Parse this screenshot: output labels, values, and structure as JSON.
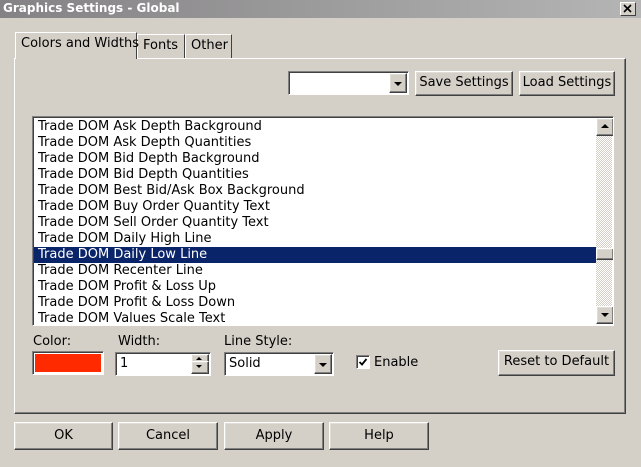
{
  "window": {
    "title": "Graphics Settings - Global"
  },
  "tabs": [
    {
      "label": "Colors and Widths",
      "active": true
    },
    {
      "label": "Fonts",
      "active": false
    },
    {
      "label": "Other",
      "active": false
    }
  ],
  "toolbar": {
    "preset_value": "",
    "save_label": "Save Settings",
    "load_label": "Load Settings"
  },
  "list": {
    "items": [
      "Trade DOM Ask Depth Background",
      "Trade DOM Ask Depth Quantities",
      "Trade DOM Bid Depth Background",
      "Trade DOM Bid Depth Quantities",
      "Trade DOM Best Bid/Ask Box Background",
      "Trade DOM Buy Order Quantity Text",
      "Trade DOM Sell Order Quantity Text",
      "Trade DOM Daily High Line",
      "Trade DOM Daily Low Line",
      "Trade DOM Recenter Line",
      "Trade DOM Profit & Loss Up",
      "Trade DOM Profit & Loss Down",
      "Trade DOM Values Scale Text"
    ],
    "selected_index": 8
  },
  "settings": {
    "color_label": "Color:",
    "color_value": "#ff2a00",
    "width_label": "Width:",
    "width_value": "1",
    "line_style_label": "Line Style:",
    "line_style_value": "Solid",
    "enable_label": "Enable",
    "enable_checked": true,
    "reset_label": "Reset to Default"
  },
  "footer": {
    "ok": "OK",
    "cancel": "Cancel",
    "apply": "Apply",
    "help": "Help"
  },
  "colors": {
    "selection": "#0a246a",
    "face": "#d4d0c8"
  }
}
